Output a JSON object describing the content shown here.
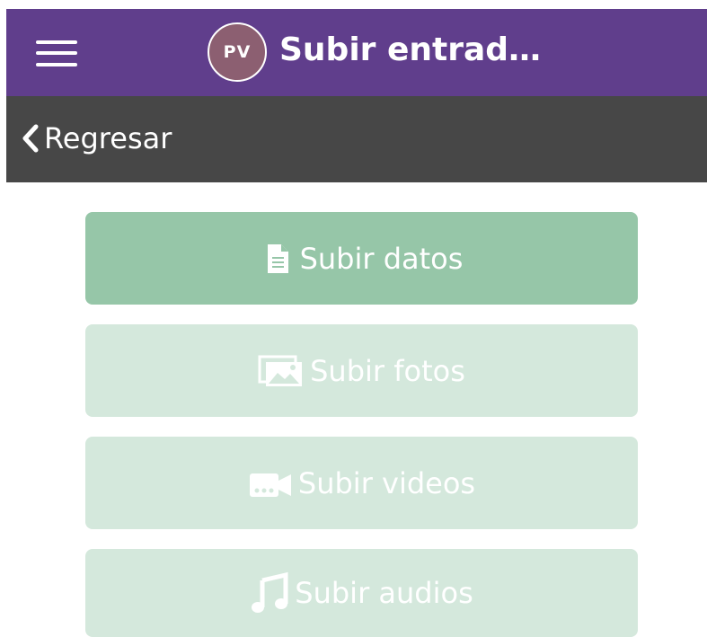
{
  "header": {
    "menu_icon": "hamburger-icon",
    "avatar_initials": "PV",
    "avatar_color": "#8c5f71",
    "title": "Subir entrad…",
    "background": "#603e8c"
  },
  "subbar": {
    "back_icon": "chevron-left-icon",
    "back_label": "Regresar",
    "background": "#474747"
  },
  "actions": [
    {
      "label": "Subir datos",
      "icon": "document-icon",
      "state": "active",
      "color": "#96c6a8"
    },
    {
      "label": "Subir fotos",
      "icon": "images-icon",
      "state": "disabled",
      "color": "#d4e8dc"
    },
    {
      "label": "Subir videos",
      "icon": "video-camera-icon",
      "state": "disabled",
      "color": "#d4e8dc"
    },
    {
      "label": "Subir audios",
      "icon": "music-note-icon",
      "state": "disabled",
      "color": "#d4e8dc"
    }
  ]
}
